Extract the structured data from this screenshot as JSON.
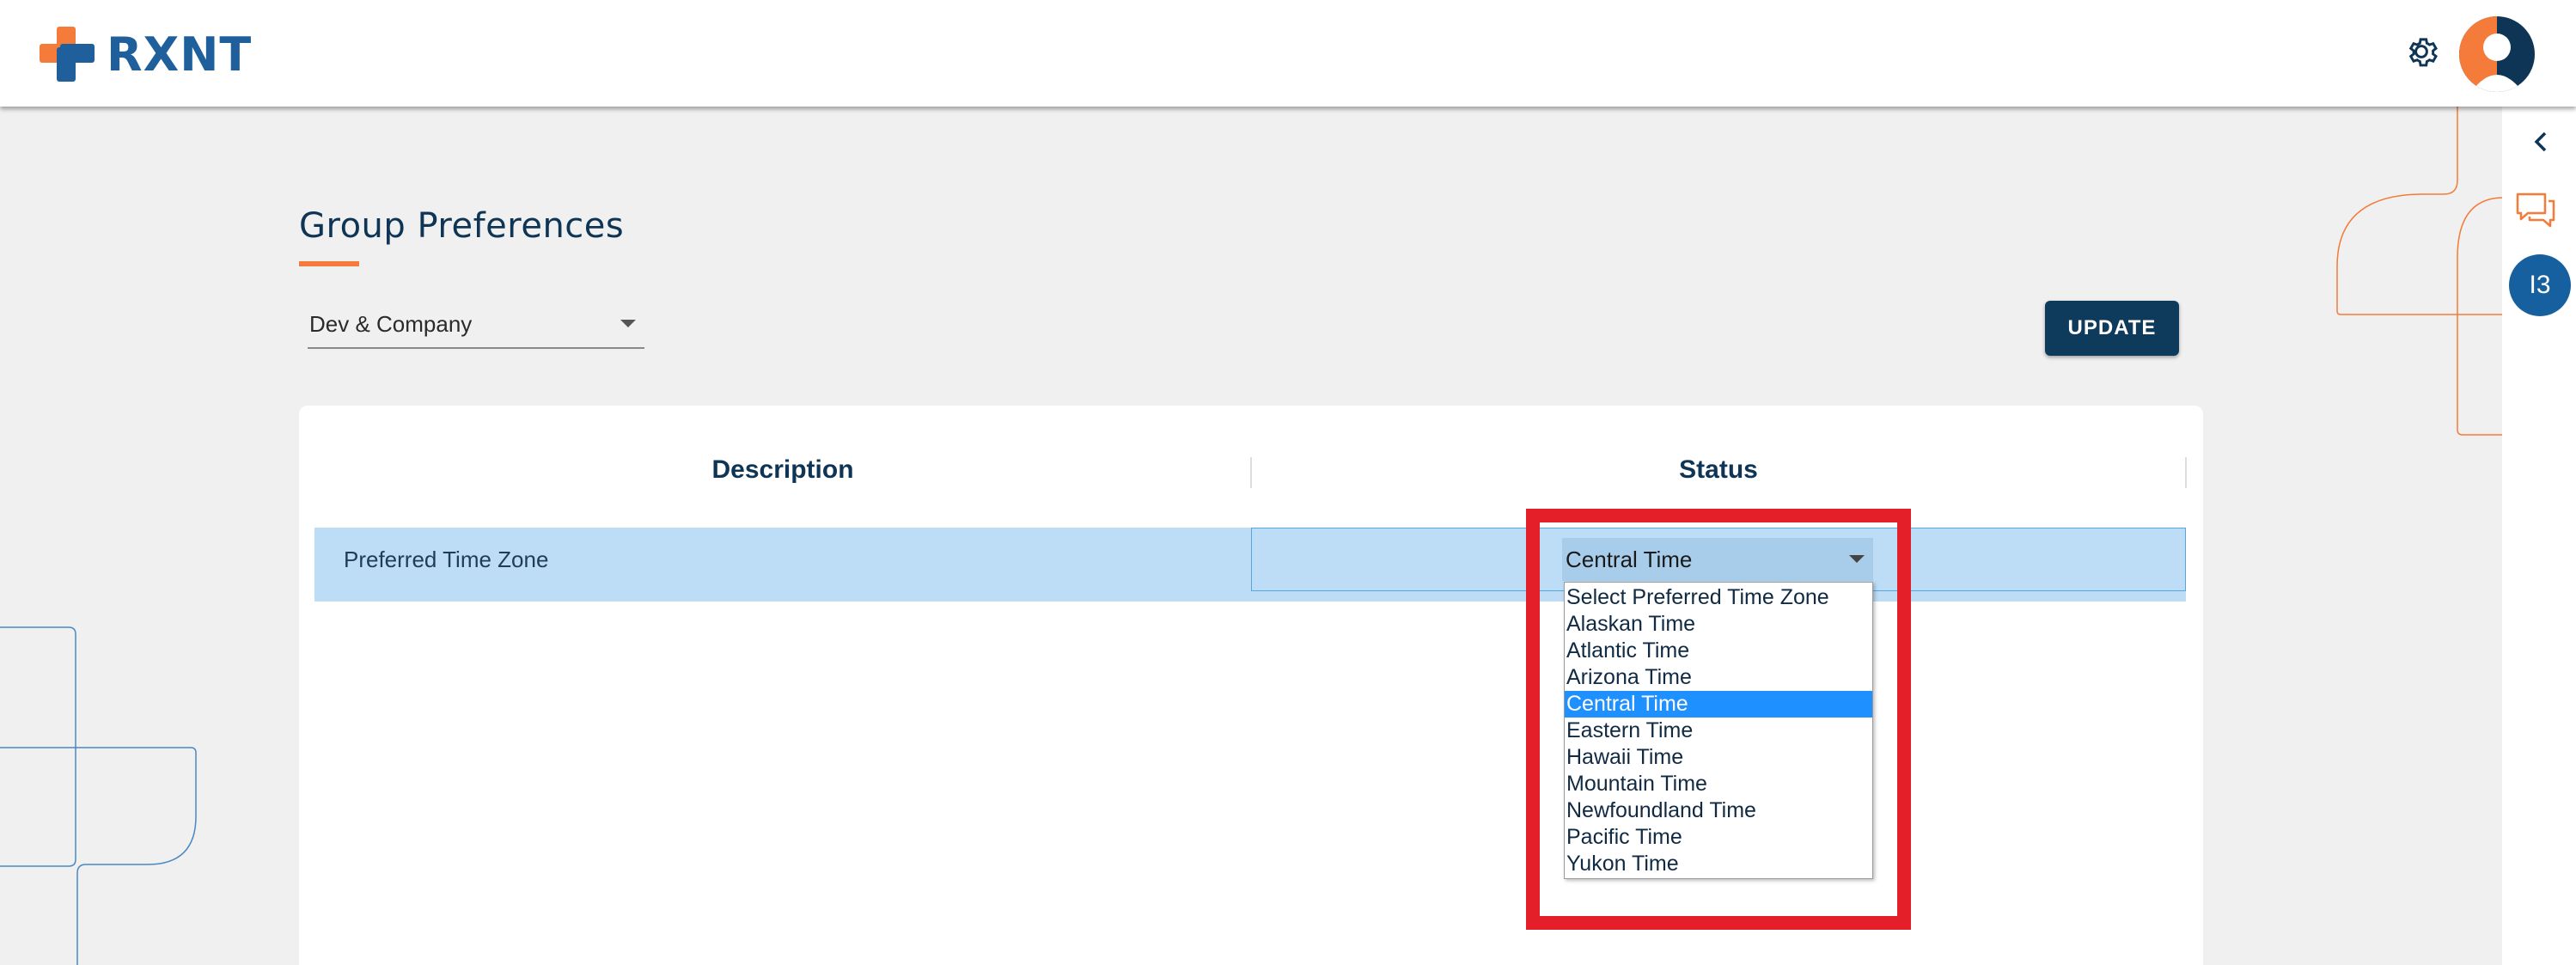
{
  "header": {
    "brand": "RXNT",
    "brand_colors": {
      "orange": "#f47b39",
      "blue": "#1f5f9b"
    }
  },
  "rail": {
    "badge": "I3"
  },
  "page": {
    "title": "Group Preferences",
    "group_select_value": "Dev & Company",
    "update_label": "UPDATE"
  },
  "table": {
    "headers": [
      "Description",
      "Status"
    ],
    "rows": [
      {
        "description": "Preferred Time Zone",
        "status": "Central Time"
      }
    ]
  },
  "timezone_dropdown": {
    "selected": "Central Time",
    "options": [
      "Select Preferred Time Zone",
      "Alaskan Time",
      "Atlantic Time",
      "Arizona Time",
      "Central Time",
      "Eastern Time",
      "Hawaii Time",
      "Mountain Time",
      "Newfoundland Time",
      "Pacific Time",
      "Yukon Time"
    ],
    "highlighted_index": 4
  },
  "colors": {
    "accent": "#f47b39",
    "primary": "#0e3a5c",
    "row_highlight": "#bddcf6",
    "option_selected": "#1e90ff",
    "annotation_red": "#e41f2a"
  }
}
